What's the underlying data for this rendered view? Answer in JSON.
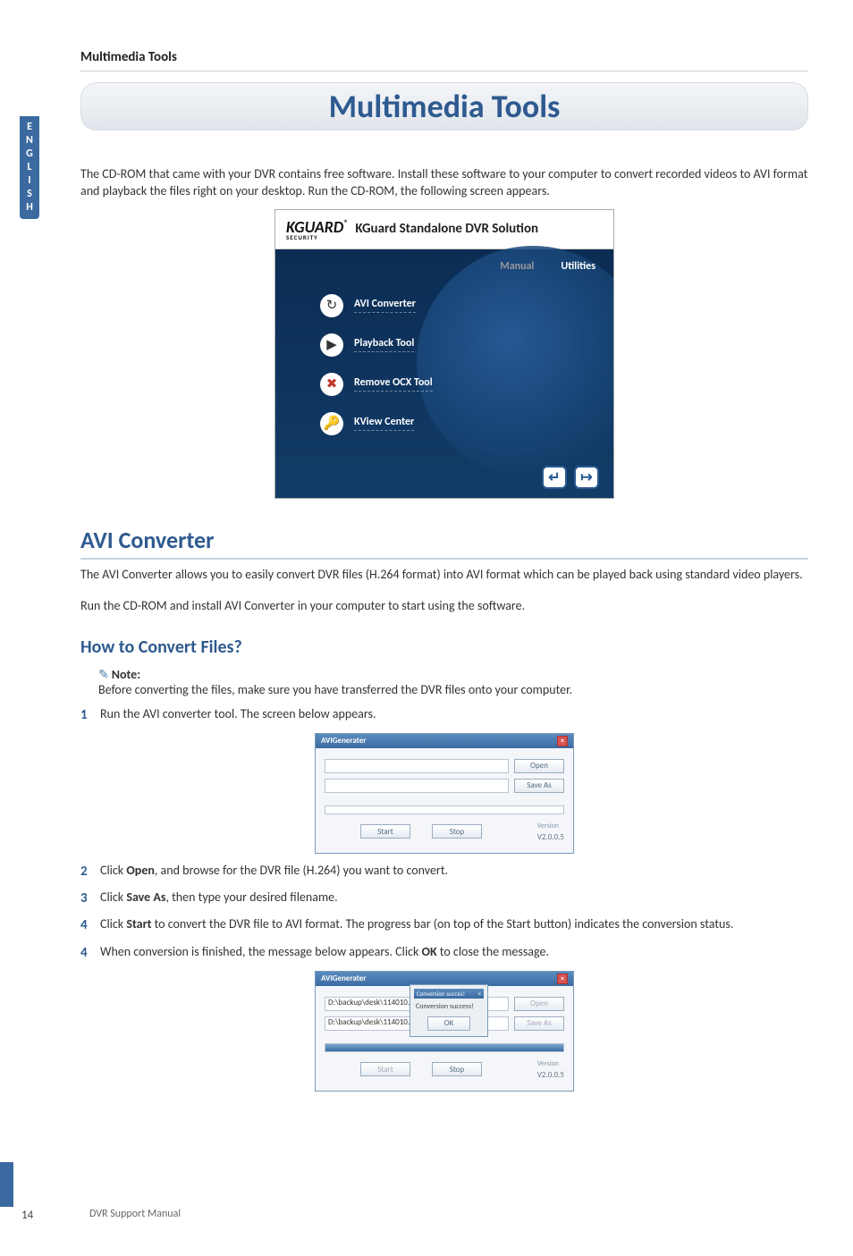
{
  "header_small": "Multimedia Tools",
  "page_title": "Multimedia Tools",
  "side_tab": "ENGLISH",
  "intro": "The CD-ROM that came with your DVR contains free software. Install these software to your computer to convert recorded videos to AVI format and playback the files right on your desktop. Run the CD-ROM, the following screen appears.",
  "kguard": {
    "logo_main": "KGUARD",
    "logo_sub": "SECURITY",
    "title": "KGuard Standalone DVR Solution",
    "tab_inactive": "Manual",
    "tab_active": "Utilities",
    "items": [
      {
        "icon": "↻",
        "label": "AVI Converter"
      },
      {
        "icon": "▶",
        "label": "Playback Tool"
      },
      {
        "icon": "✖",
        "label": "Remove OCX Tool"
      },
      {
        "icon": "🔑",
        "label": "KView Center"
      }
    ],
    "footer_enter": "↵",
    "footer_exit": "↦"
  },
  "section1": {
    "title": "AVI Converter",
    "p1": "The AVI Converter allows you to easily convert DVR files (H.264 format) into AVI format which can be played back using standard video players.",
    "p2": "Run the CD-ROM and install AVI Converter in your computer to start using the software."
  },
  "howto": {
    "title": "How to Convert Files?",
    "note_label": "Note:",
    "note_text": "Before converting the files, make sure you have transferred the DVR files onto your computer.",
    "steps": [
      {
        "num": "1",
        "pre": "Run the AVI converter tool. The screen below appears."
      },
      {
        "num": "2",
        "pre": "Click ",
        "bold": "Open",
        "post": ", and browse for the DVR file (H.264) you want to convert."
      },
      {
        "num": "3",
        "pre": "Click ",
        "bold": "Save As",
        "post": ", then type your desired filename."
      },
      {
        "num": "4",
        "pre": "Click ",
        "bold": "Start",
        "post": " to convert the DVR file to AVI format. The progress bar (on top of the Start button) indicates the conversion status."
      },
      {
        "num": "4",
        "pre": "When conversion is finished, the message below appears. Click ",
        "bold": "OK",
        "post": " to close the message."
      }
    ]
  },
  "converter": {
    "title": "AVIGenerater",
    "open": "Open",
    "save_as": "Save As",
    "start": "Start",
    "stop": "Stop",
    "version_label": "Version",
    "version_value": "V2.0.0.5"
  },
  "converter2": {
    "path1": "D:\\backup\\desk\\114010.254",
    "path2": "D:\\backup\\desk\\114010.avi",
    "popup_title": "Conversion succes!",
    "popup_msg": "Conversion success!",
    "ok": "OK"
  },
  "footer": "DVR Support Manual",
  "page_num": "14"
}
